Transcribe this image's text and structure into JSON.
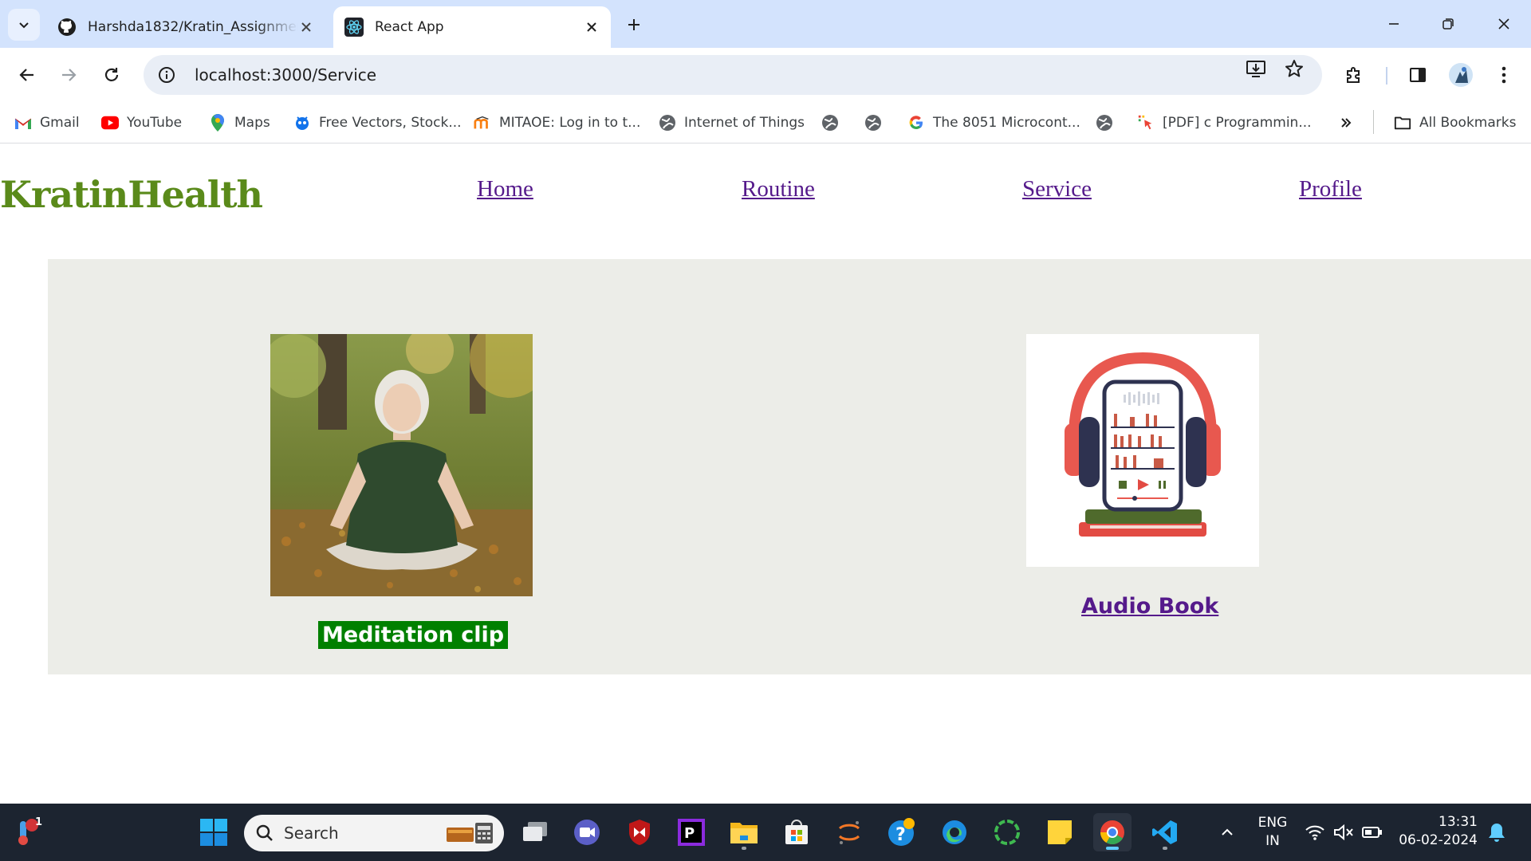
{
  "browser": {
    "tabs": [
      {
        "title": "Harshda1832/Kratin_Assignment",
        "active": false
      },
      {
        "title": "React App",
        "active": true
      }
    ],
    "url": "localhost:3000/Service",
    "bookmarks": [
      {
        "label": "Gmail"
      },
      {
        "label": "YouTube"
      },
      {
        "label": "Maps"
      },
      {
        "label": "Free Vectors, Stock..."
      },
      {
        "label": "MITAOE: Log in to t..."
      },
      {
        "label": "Internet of Things"
      },
      {
        "label": ""
      },
      {
        "label": ""
      },
      {
        "label": "The 8051 Microcont..."
      },
      {
        "label": ""
      },
      {
        "label": "[PDF] c Programmin..."
      }
    ],
    "all_bookmarks_label": "All Bookmarks"
  },
  "site": {
    "brand": "KratinHealth",
    "nav": [
      {
        "label": "Home"
      },
      {
        "label": "Routine"
      },
      {
        "label": "Service"
      },
      {
        "label": "Profile"
      }
    ],
    "services": [
      {
        "label": "Meditation clip"
      },
      {
        "label": "Audio Book"
      }
    ]
  },
  "taskbar": {
    "search_placeholder": "Search",
    "notification_badge": "1",
    "language": "ENG",
    "region": "IN",
    "time": "13:31",
    "date": "06-02-2024"
  },
  "colors": {
    "tabstrip": "#d3e3fd",
    "brand": "#5a8a1a",
    "nav_link": "#551a8b",
    "services_bg": "#ecede8",
    "meditation_label_bg": "#008000",
    "taskbar": "#1c2430"
  }
}
